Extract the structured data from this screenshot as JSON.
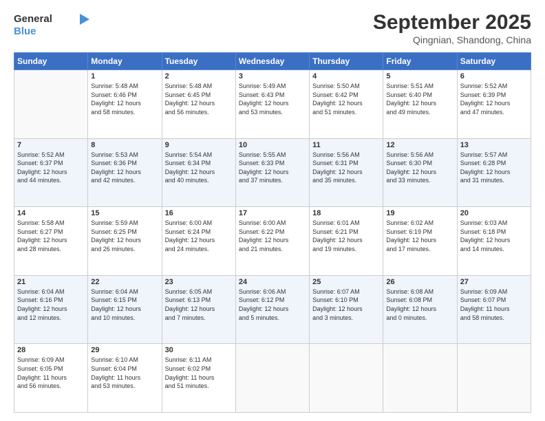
{
  "header": {
    "logo_general": "General",
    "logo_blue": "Blue",
    "month": "September 2025",
    "location": "Qingnian, Shandong, China"
  },
  "days_of_week": [
    "Sunday",
    "Monday",
    "Tuesday",
    "Wednesday",
    "Thursday",
    "Friday",
    "Saturday"
  ],
  "weeks": [
    [
      {
        "day": "",
        "info": ""
      },
      {
        "day": "1",
        "info": "Sunrise: 5:48 AM\nSunset: 6:46 PM\nDaylight: 12 hours\nand 58 minutes."
      },
      {
        "day": "2",
        "info": "Sunrise: 5:48 AM\nSunset: 6:45 PM\nDaylight: 12 hours\nand 56 minutes."
      },
      {
        "day": "3",
        "info": "Sunrise: 5:49 AM\nSunset: 6:43 PM\nDaylight: 12 hours\nand 53 minutes."
      },
      {
        "day": "4",
        "info": "Sunrise: 5:50 AM\nSunset: 6:42 PM\nDaylight: 12 hours\nand 51 minutes."
      },
      {
        "day": "5",
        "info": "Sunrise: 5:51 AM\nSunset: 6:40 PM\nDaylight: 12 hours\nand 49 minutes."
      },
      {
        "day": "6",
        "info": "Sunrise: 5:52 AM\nSunset: 6:39 PM\nDaylight: 12 hours\nand 47 minutes."
      }
    ],
    [
      {
        "day": "7",
        "info": "Sunrise: 5:52 AM\nSunset: 6:37 PM\nDaylight: 12 hours\nand 44 minutes."
      },
      {
        "day": "8",
        "info": "Sunrise: 5:53 AM\nSunset: 6:36 PM\nDaylight: 12 hours\nand 42 minutes."
      },
      {
        "day": "9",
        "info": "Sunrise: 5:54 AM\nSunset: 6:34 PM\nDaylight: 12 hours\nand 40 minutes."
      },
      {
        "day": "10",
        "info": "Sunrise: 5:55 AM\nSunset: 6:33 PM\nDaylight: 12 hours\nand 37 minutes."
      },
      {
        "day": "11",
        "info": "Sunrise: 5:56 AM\nSunset: 6:31 PM\nDaylight: 12 hours\nand 35 minutes."
      },
      {
        "day": "12",
        "info": "Sunrise: 5:56 AM\nSunset: 6:30 PM\nDaylight: 12 hours\nand 33 minutes."
      },
      {
        "day": "13",
        "info": "Sunrise: 5:57 AM\nSunset: 6:28 PM\nDaylight: 12 hours\nand 31 minutes."
      }
    ],
    [
      {
        "day": "14",
        "info": "Sunrise: 5:58 AM\nSunset: 6:27 PM\nDaylight: 12 hours\nand 28 minutes."
      },
      {
        "day": "15",
        "info": "Sunrise: 5:59 AM\nSunset: 6:25 PM\nDaylight: 12 hours\nand 26 minutes."
      },
      {
        "day": "16",
        "info": "Sunrise: 6:00 AM\nSunset: 6:24 PM\nDaylight: 12 hours\nand 24 minutes."
      },
      {
        "day": "17",
        "info": "Sunrise: 6:00 AM\nSunset: 6:22 PM\nDaylight: 12 hours\nand 21 minutes."
      },
      {
        "day": "18",
        "info": "Sunrise: 6:01 AM\nSunset: 6:21 PM\nDaylight: 12 hours\nand 19 minutes."
      },
      {
        "day": "19",
        "info": "Sunrise: 6:02 AM\nSunset: 6:19 PM\nDaylight: 12 hours\nand 17 minutes."
      },
      {
        "day": "20",
        "info": "Sunrise: 6:03 AM\nSunset: 6:18 PM\nDaylight: 12 hours\nand 14 minutes."
      }
    ],
    [
      {
        "day": "21",
        "info": "Sunrise: 6:04 AM\nSunset: 6:16 PM\nDaylight: 12 hours\nand 12 minutes."
      },
      {
        "day": "22",
        "info": "Sunrise: 6:04 AM\nSunset: 6:15 PM\nDaylight: 12 hours\nand 10 minutes."
      },
      {
        "day": "23",
        "info": "Sunrise: 6:05 AM\nSunset: 6:13 PM\nDaylight: 12 hours\nand 7 minutes."
      },
      {
        "day": "24",
        "info": "Sunrise: 6:06 AM\nSunset: 6:12 PM\nDaylight: 12 hours\nand 5 minutes."
      },
      {
        "day": "25",
        "info": "Sunrise: 6:07 AM\nSunset: 6:10 PM\nDaylight: 12 hours\nand 3 minutes."
      },
      {
        "day": "26",
        "info": "Sunrise: 6:08 AM\nSunset: 6:08 PM\nDaylight: 12 hours\nand 0 minutes."
      },
      {
        "day": "27",
        "info": "Sunrise: 6:09 AM\nSunset: 6:07 PM\nDaylight: 11 hours\nand 58 minutes."
      }
    ],
    [
      {
        "day": "28",
        "info": "Sunrise: 6:09 AM\nSunset: 6:05 PM\nDaylight: 11 hours\nand 56 minutes."
      },
      {
        "day": "29",
        "info": "Sunrise: 6:10 AM\nSunset: 6:04 PM\nDaylight: 11 hours\nand 53 minutes."
      },
      {
        "day": "30",
        "info": "Sunrise: 6:11 AM\nSunset: 6:02 PM\nDaylight: 11 hours\nand 51 minutes."
      },
      {
        "day": "",
        "info": ""
      },
      {
        "day": "",
        "info": ""
      },
      {
        "day": "",
        "info": ""
      },
      {
        "day": "",
        "info": ""
      }
    ]
  ]
}
